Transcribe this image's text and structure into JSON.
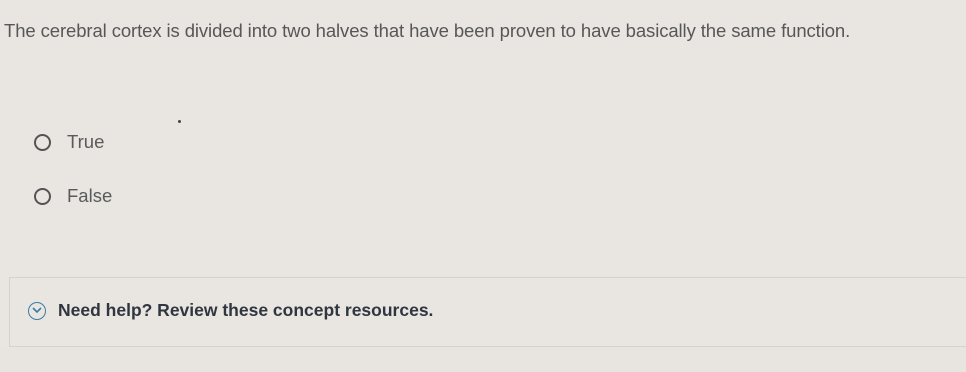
{
  "question": {
    "text": "The cerebral cortex is divided into two halves that have been proven to have basically the same function."
  },
  "options": [
    {
      "label": "True",
      "selected": false
    },
    {
      "label": "False",
      "selected": false
    }
  ],
  "help": {
    "text": "Need help? Review these concept resources.",
    "icon": "chevron-down-circle-icon",
    "accent_color": "#3a7ca5"
  }
}
